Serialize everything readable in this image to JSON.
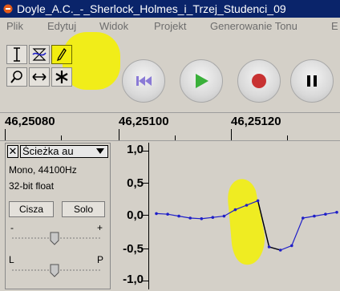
{
  "window": {
    "title": "Doyle_A.C._-_Sherlock_Holmes_i_Trzej_Studenci_09"
  },
  "menu": {
    "items": [
      "Plik",
      "Edytuj",
      "Widok",
      "Projekt",
      "Generowanie Tonu",
      "E"
    ]
  },
  "tools": {
    "selection_icon": "text-cursor-icon",
    "envelope_icon": "envelope-icon",
    "draw_icon": "pencil-icon",
    "zoom_icon": "magnifier-icon",
    "timeshift_icon": "time-shift-icon",
    "multi_icon": "multi-tool-icon"
  },
  "transport": {
    "buttons": [
      "skip-to-start-icon",
      "play-icon",
      "record-icon",
      "pause-icon"
    ]
  },
  "ruler": {
    "labels": [
      "46,25080",
      "46,25100",
      "46,25120"
    ]
  },
  "track": {
    "close_label": "✕",
    "name": "Ścieżka au",
    "format_rate": "Mono, 44100Hz",
    "format_bits": "32-bit float",
    "mute_label": "Cisza",
    "solo_label": "Solo",
    "gain_minus": "-",
    "gain_plus": "+",
    "pan_left": "L",
    "pan_right": "P"
  },
  "amplitude_ruler": {
    "labels": [
      "1,0",
      "0,5",
      "0,0",
      "-0,5",
      "-1,0"
    ]
  },
  "colors": {
    "title_bg": "#0a246a",
    "highlight": "#f2ee10",
    "wave_line": "#1f1fc8",
    "play_green": "#3ab03a",
    "record_red": "#c83232",
    "skip_purple": "#8a7ad6"
  },
  "waveform": {
    "samples": [
      0.02,
      0.01,
      -0.02,
      -0.05,
      -0.06,
      -0.04,
      -0.02,
      0.08,
      0.15,
      0.22,
      -0.5,
      -0.55,
      -0.48,
      -0.05,
      -0.02,
      0.01,
      0.04
    ]
  }
}
